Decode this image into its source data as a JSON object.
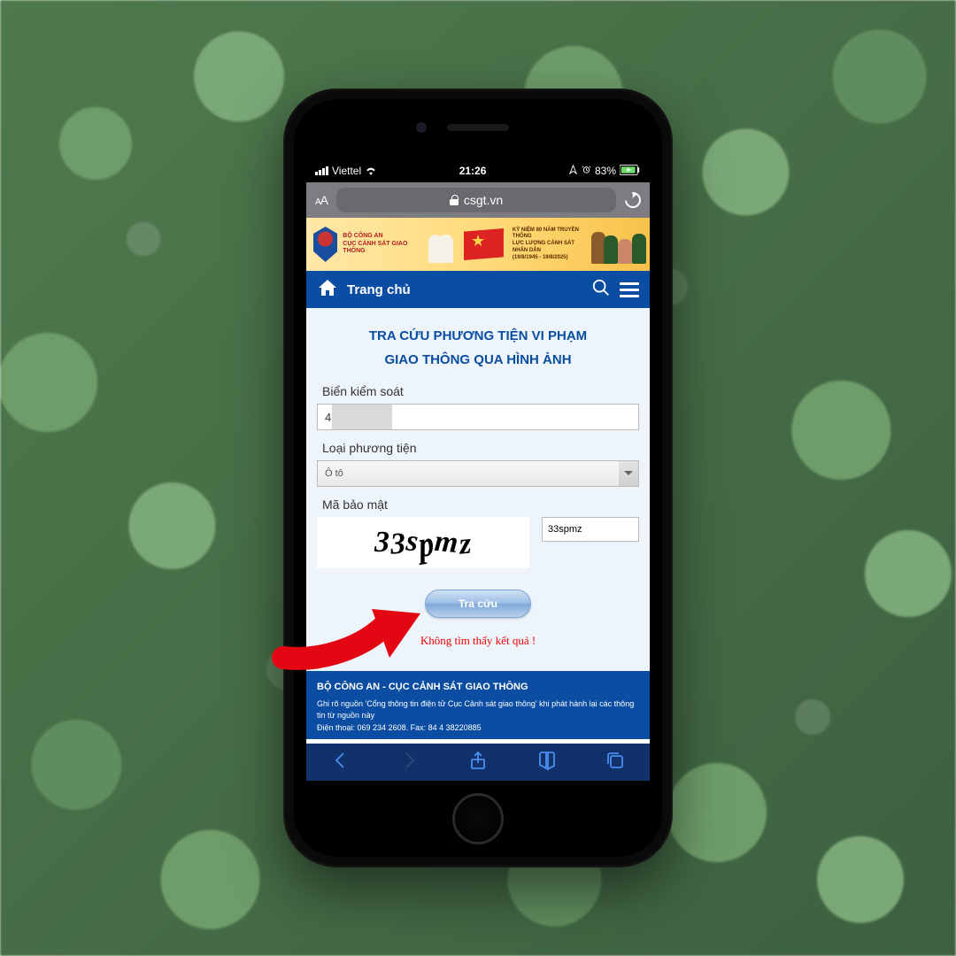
{
  "status": {
    "carrier": "Viettel",
    "time": "21:26",
    "battery": "83%"
  },
  "address_bar": {
    "domain": "csgt.vn"
  },
  "banner": {
    "line1": "BỘ CÔNG AN",
    "line2": "CỤC CẢNH SÁT GIAO THÔNG",
    "promo1": "KỶ NIỆM 80 NĂM TRUYỀN THỐNG",
    "promo2": "LỰC LƯỢNG CẢNH SÁT NHÂN DÂN",
    "promo3": "(19/8/1945 - 19/8/2025)"
  },
  "nav": {
    "home_label": "Trang chủ"
  },
  "form": {
    "heading_line1": "TRA CỨU PHƯƠNG TIỆN VI PHẠM",
    "heading_line2": "GIAO THÔNG QUA HÌNH ẢNH",
    "plate_label": "Biển kiểm soát",
    "plate_value": "4",
    "vehicle_label": "Loại phương tiện",
    "vehicle_value": "Ô tô",
    "captcha_label": "Mã bảo mật",
    "captcha_text": "33spmz",
    "captcha_input_value": "33spmz",
    "submit_label": "Tra cứu",
    "result_message": "Không tìm thấy kết quả !"
  },
  "footer": {
    "title": "BỘ CÔNG AN - CỤC CẢNH SÁT GIAO THÔNG",
    "attribution": "Ghi rõ nguồn 'Cổng thông tin điện tử Cục Cảnh sát giao thông' khi phát hành lại các thông tin từ nguồn này",
    "contact": "Điện thoại: 069 234 2608. Fax: 84 4 38220885"
  }
}
